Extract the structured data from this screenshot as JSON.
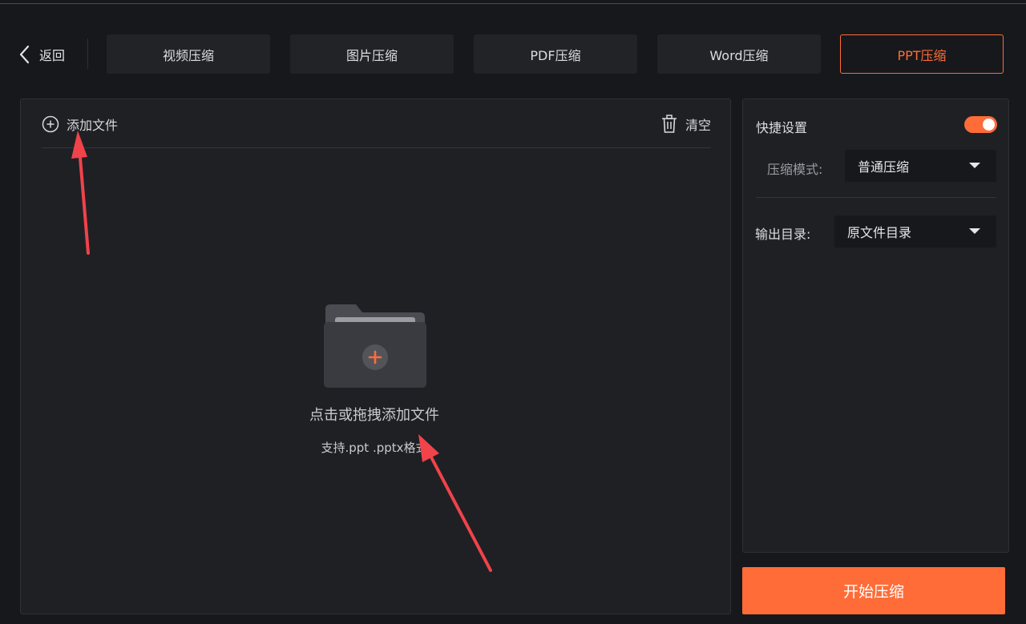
{
  "nav": {
    "back_label": "返回",
    "tabs": [
      {
        "label": "视频压缩",
        "active": false
      },
      {
        "label": "图片压缩",
        "active": false
      },
      {
        "label": "PDF压缩",
        "active": false
      },
      {
        "label": "Word压缩",
        "active": false
      },
      {
        "label": "PPT压缩",
        "active": true
      }
    ]
  },
  "file_panel": {
    "add_file_label": "添加文件",
    "clear_label": "清空",
    "drop_hint": "点击或拖拽添加文件",
    "format_hint": "支持.ppt .pptx格式"
  },
  "settings": {
    "quick_settings_label": "快捷设置",
    "quick_settings_enabled": true,
    "compress_mode_label": "压缩模式:",
    "compress_mode_value": "普通压缩",
    "output_dir_label": "输出目录:",
    "output_dir_value": "原文件目录"
  },
  "start_button_label": "开始压缩",
  "icons": {
    "back": "chevron-left-icon",
    "add": "plus-circle-icon",
    "clear": "trash-icon",
    "folder": "folder-plus-icon",
    "dropdown": "caret-down-icon"
  },
  "colors": {
    "accent": "#ff6c38",
    "background": "#17181b",
    "panel": "#1f2024",
    "annotation_arrow": "#f0434a"
  }
}
